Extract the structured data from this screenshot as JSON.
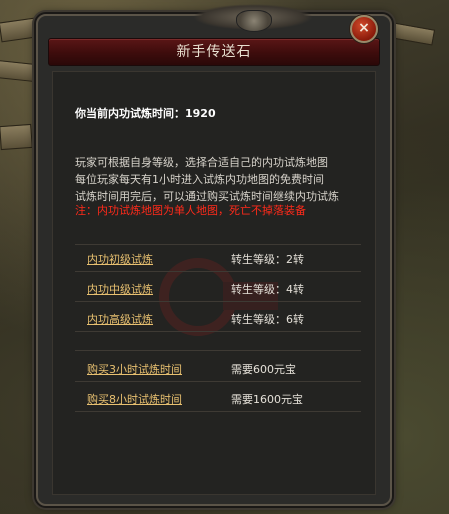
{
  "dialog": {
    "title": "新手传送石",
    "close_label": "×"
  },
  "status": {
    "time_line": "你当前内功试炼时间：1920"
  },
  "description": {
    "lines": [
      "玩家可根据自身等级，选择合适自己的内功试炼地图",
      "每位玩家每天有1小时进入试炼内功地图的免费时间",
      "试炼时间用完后，可以通过购买试炼时间继续内功试炼"
    ],
    "warning": "注：内功试炼地图为单人地图，死亡不掉落装备"
  },
  "trials": [
    {
      "label": "内功初级试炼",
      "info": "转生等级：2转"
    },
    {
      "label": "内功中级试炼",
      "info": "转生等级：4转"
    },
    {
      "label": "内功高级试炼",
      "info": "转生等级：6转"
    }
  ],
  "purchases": [
    {
      "label": "购买3小时试炼时间",
      "info": "需要600元宝"
    },
    {
      "label": "购买8小时试炼时间",
      "info": "需要1600元宝"
    }
  ],
  "colors": {
    "link": "#e8c070",
    "warning": "#ff2a1a",
    "title_bar": "#4a1010",
    "panel": "#232321"
  }
}
